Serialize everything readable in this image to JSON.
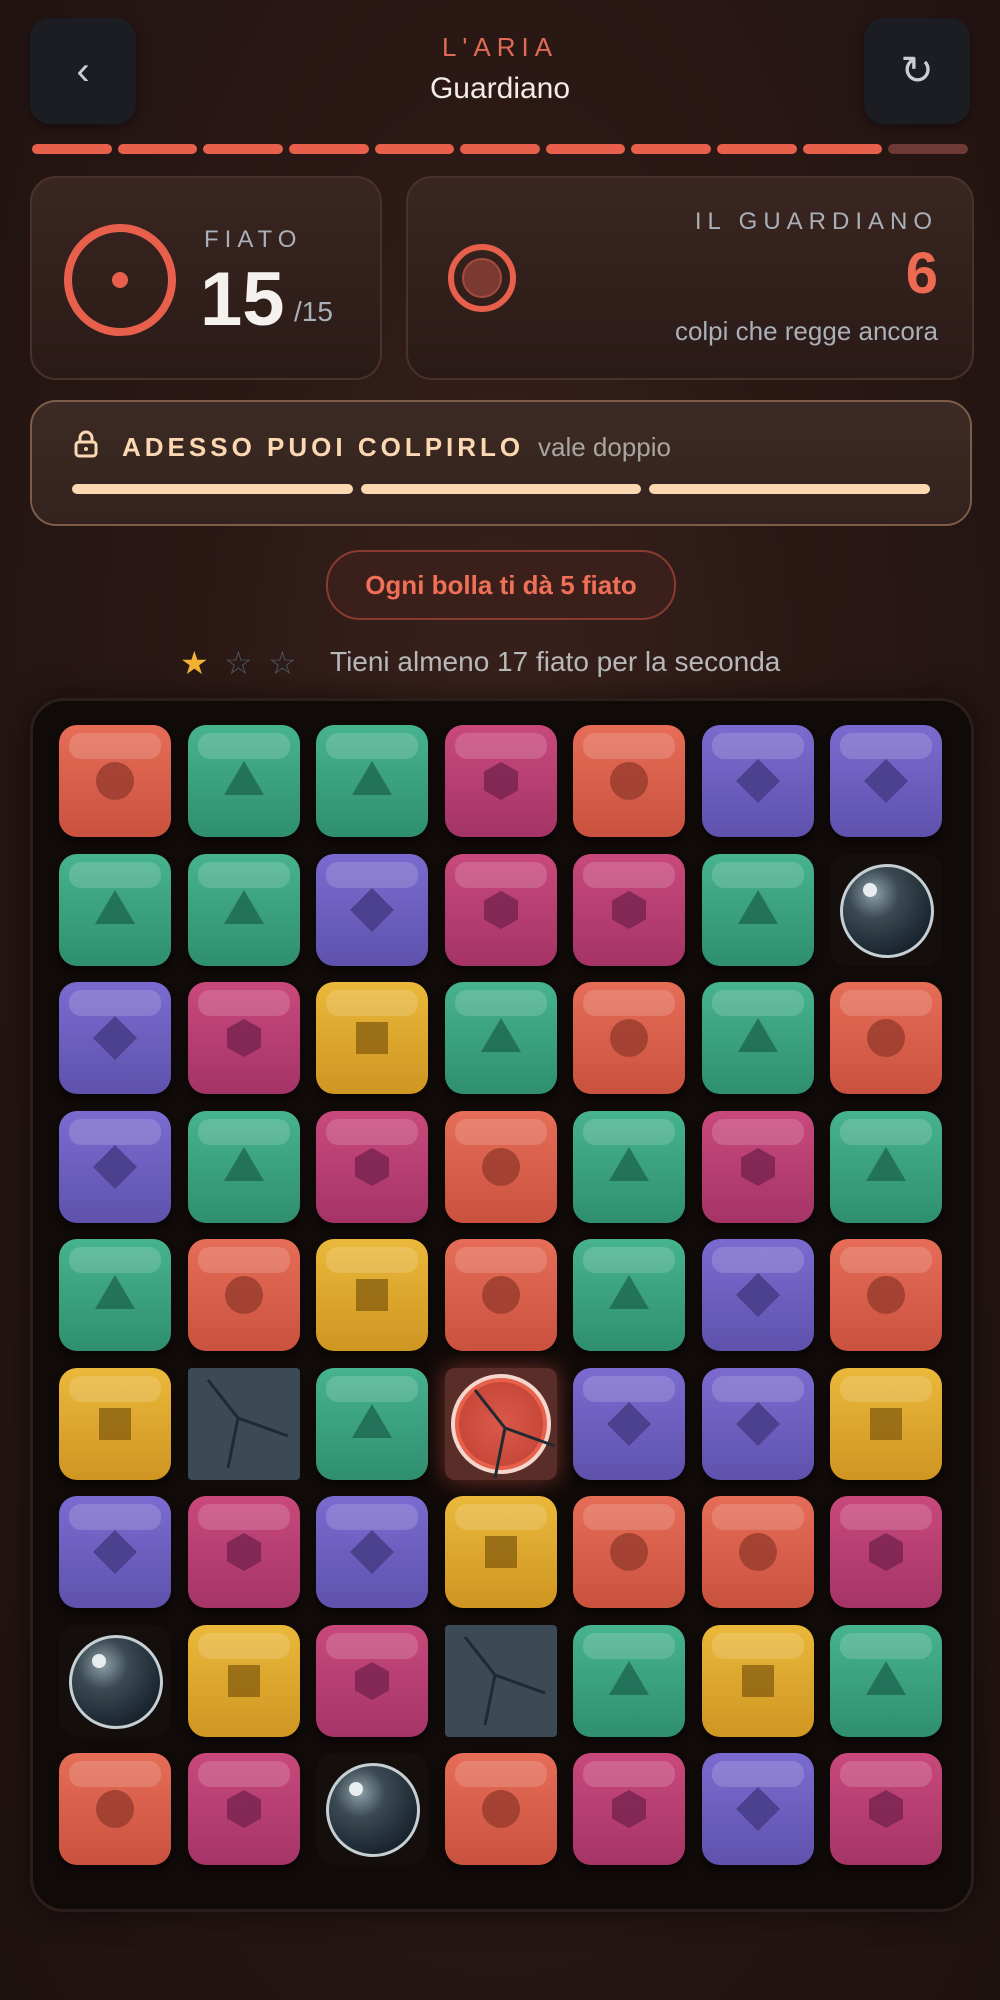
{
  "header": {
    "back_icon": "‹",
    "restart_icon": "↻",
    "world": "L'ARIA",
    "level": "Guardiano",
    "progress": {
      "filled": 10,
      "total": 11
    }
  },
  "breath": {
    "label": "FIATO",
    "value": "15",
    "max": "/15"
  },
  "guardian": {
    "title": "IL GUARDIANO",
    "value": "6",
    "subtitle": "colpi che regge ancora"
  },
  "unlock": {
    "title": "ADESSO PUOI COLPIRLO",
    "subtitle": "vale doppio",
    "bars": 3
  },
  "bonus_pill": "Ogni bolla ti dà 5 fiato",
  "stars": {
    "earned": 1,
    "total": 3,
    "goal_text": "Tieni almeno 17 fiato per la seconda"
  },
  "colors": {
    "accent": "#e8604b",
    "cream": "#fbd8b2",
    "star": "#f2b233"
  },
  "board": {
    "cols": 7,
    "rows": 9,
    "cells": [
      [
        "coral",
        "green",
        "green",
        "pink",
        "coral",
        "purple",
        "purple"
      ],
      [
        "green",
        "green",
        "purple",
        "pink",
        "pink",
        "green",
        "bubble"
      ],
      [
        "purple",
        "pink",
        "gold",
        "green",
        "coral",
        "green",
        "coral"
      ],
      [
        "purple",
        "green",
        "pink",
        "coral",
        "green",
        "pink",
        "green"
      ],
      [
        "green",
        "coral",
        "gold",
        "coral",
        "green",
        "purple",
        "coral"
      ],
      [
        "gold",
        "stone",
        "green",
        "guardian",
        "purple",
        "purple",
        "gold"
      ],
      [
        "purple",
        "pink",
        "purple",
        "gold",
        "coral",
        "coral",
        "pink"
      ],
      [
        "bubble",
        "gold",
        "pink",
        "stone",
        "green",
        "gold",
        "green"
      ],
      [
        "coral",
        "pink",
        "bubble",
        "coral",
        "pink",
        "purple",
        "pink"
      ]
    ],
    "legend": {
      "coral": "circle",
      "green": "triangle",
      "purple": "diamond",
      "pink": "hexagon",
      "gold": "square",
      "stone": "cracked-stone",
      "bubble": "bubble",
      "guardian": "guardian"
    }
  }
}
